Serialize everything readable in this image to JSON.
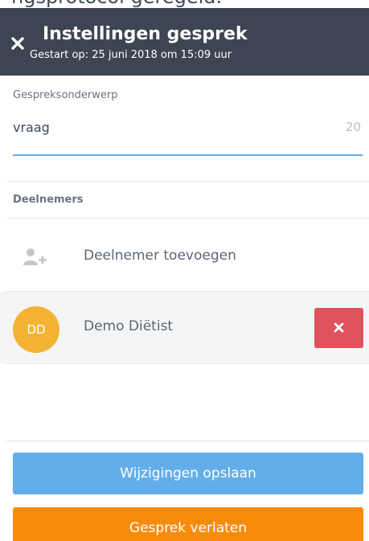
{
  "top_partial_text": "ngsprotocol geregeld.",
  "header": {
    "title": "Instellingen gesprek",
    "subtitle": "Gestart op: 25 juni 2018 om 15:09 uur",
    "close_icon": "close-icon",
    "background_color": "#3d4452"
  },
  "subject": {
    "label": "Gespreksonderwerp",
    "value": "vraag",
    "char_count": "20",
    "underline_color": "#64a9e6"
  },
  "participants": {
    "title": "Deelnemers",
    "add_label": "Deelnemer toevoegen",
    "add_icon": "add-user-icon",
    "items": [
      {
        "initials": "DD",
        "name": "Demo Diëtist",
        "avatar_color": "#f4b332",
        "remove_icon": "close-icon",
        "remove_color": "#e0525d"
      }
    ]
  },
  "actions": {
    "save_label": "Wijzigingen opslaan",
    "save_color": "#63aeea",
    "leave_label": "Gesprek verlaten",
    "leave_color": "#f78c0c"
  }
}
